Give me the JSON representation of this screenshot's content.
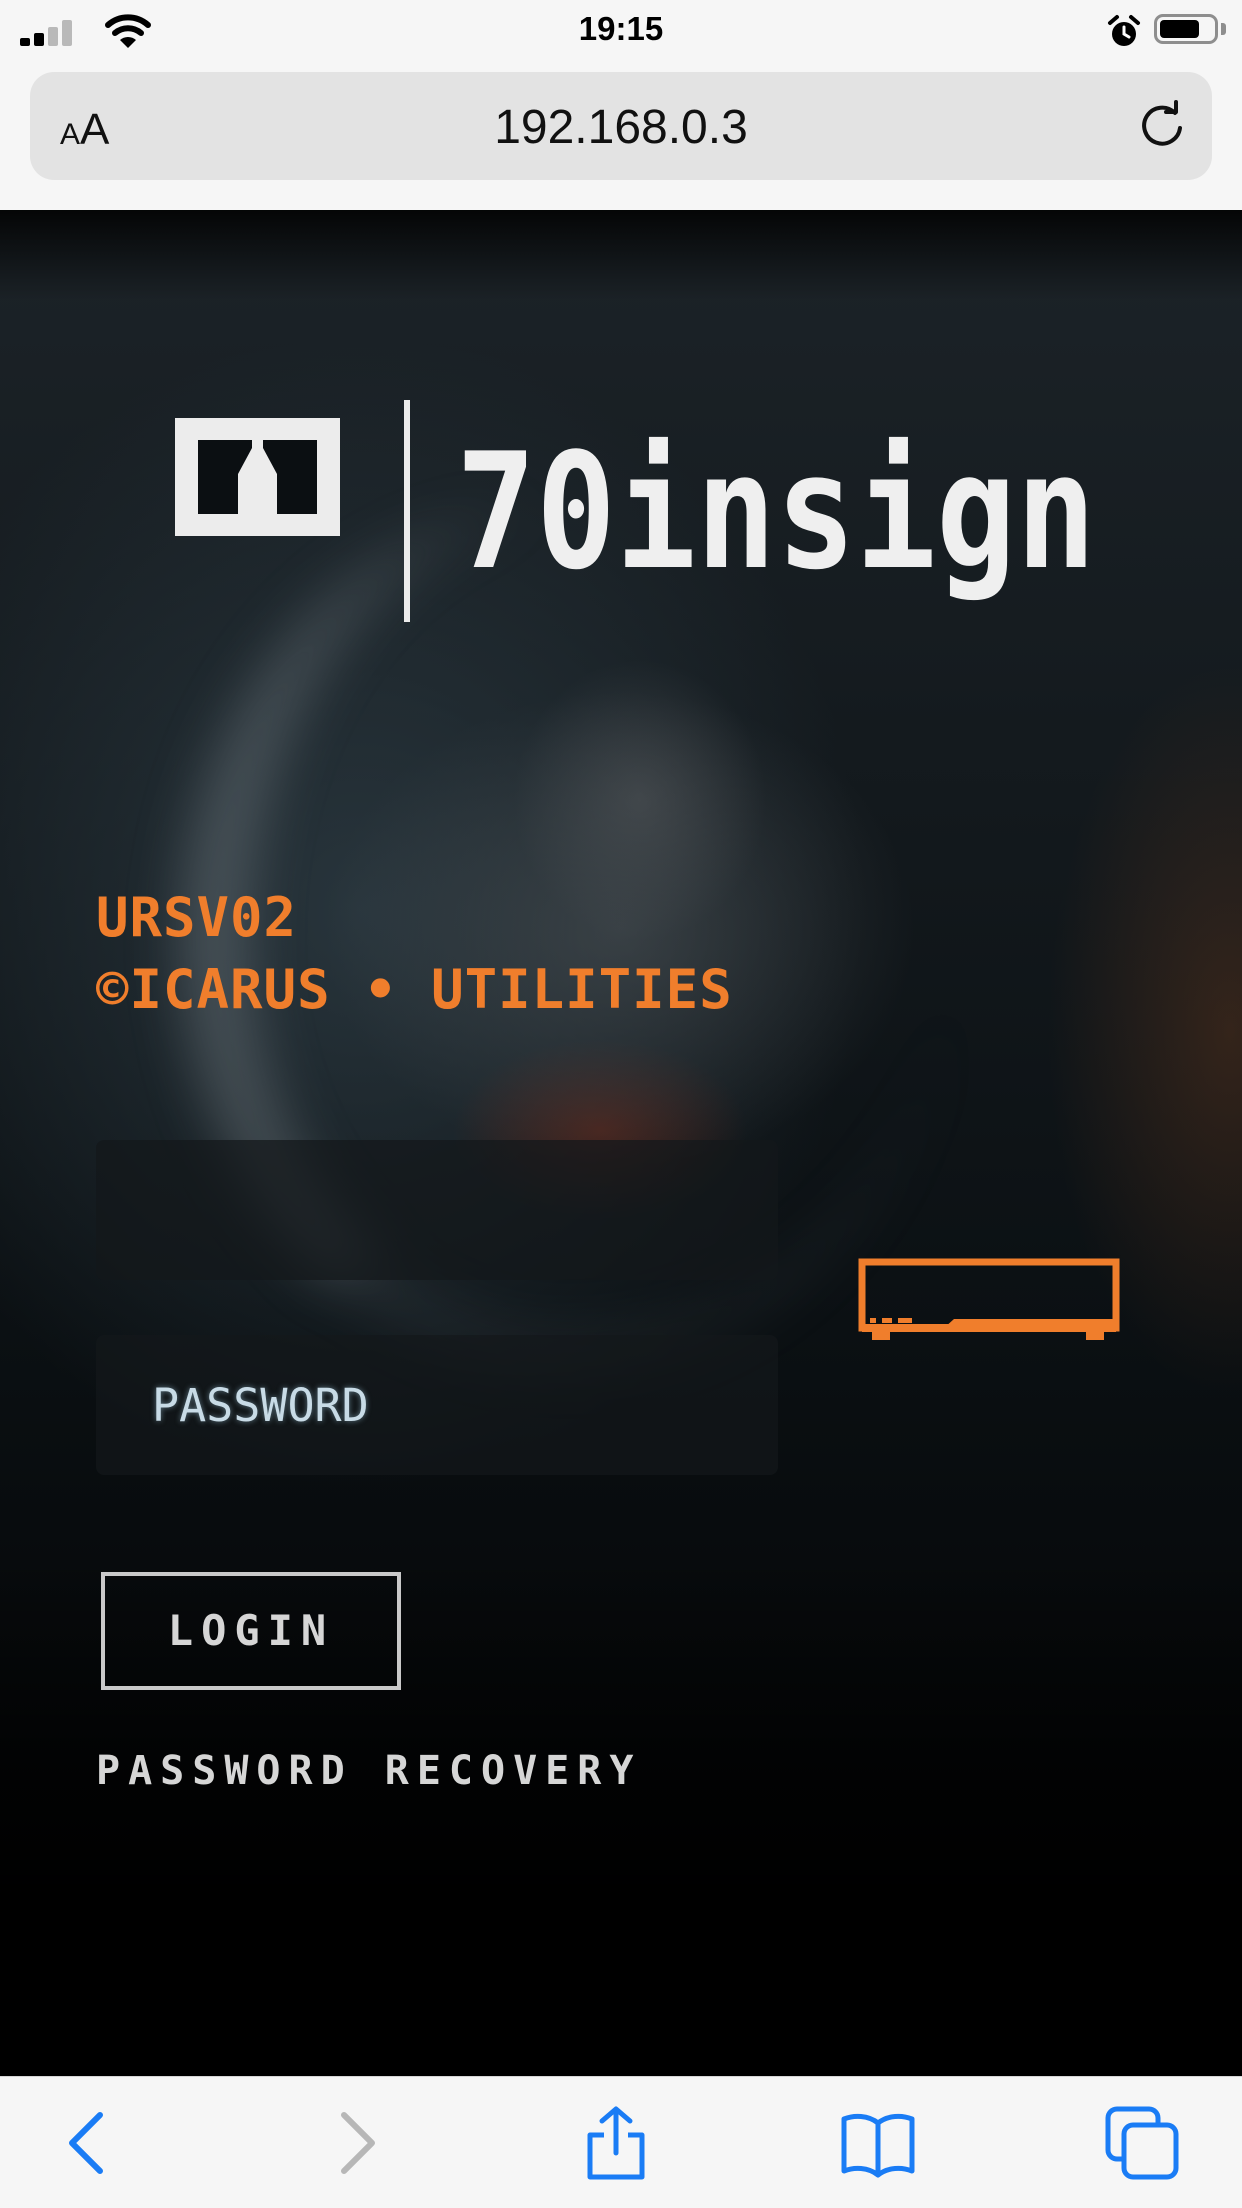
{
  "status_bar": {
    "time": "19:15",
    "icons": [
      "cellular-signal-icon",
      "wifi-icon",
      "alarm-icon",
      "battery-icon"
    ],
    "battery_level": 0.75
  },
  "address_bar": {
    "text_size_label_small": "A",
    "text_size_label_large": "A",
    "url": "192.168.0.3",
    "reload_icon": "reload-icon"
  },
  "page": {
    "logo_text": "70insign",
    "product": "URSV02",
    "company": "©ICARUS • UTILITIES",
    "username_placeholder": "",
    "password_placeholder": "PASSWORD",
    "login_label": "LOGIN",
    "recovery_label": "PASSWORD RECOVERY",
    "accent_color": "#f07e2c",
    "device_icon": "router-device-icon"
  },
  "toolbar": {
    "icons": [
      "back-icon",
      "forward-icon",
      "share-icon",
      "bookmarks-icon",
      "tabs-icon"
    ],
    "accent_color": "#1a7cf5"
  }
}
